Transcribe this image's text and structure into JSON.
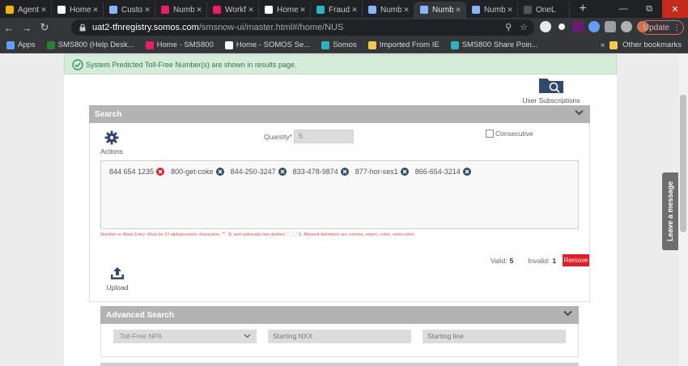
{
  "browser": {
    "tabs": [
      {
        "title": "Agent",
        "color": "#f4b400",
        "active": false
      },
      {
        "title": "Home",
        "color": "#ffffff",
        "active": false
      },
      {
        "title": "Custo",
        "color": "#8ab4f8",
        "active": false
      },
      {
        "title": "Numb",
        "color": "#e91e63",
        "active": false
      },
      {
        "title": "Workf",
        "color": "#e91e63",
        "active": false
      },
      {
        "title": "Home",
        "color": "#ffffff",
        "active": false
      },
      {
        "title": "Fraud",
        "color": "#2bb3c0",
        "active": false
      },
      {
        "title": "Numb",
        "color": "#8ab4f8",
        "active": false
      },
      {
        "title": "Numb",
        "color": "#8ab4f8",
        "active": true
      },
      {
        "title": "Numb",
        "color": "#8ab4f8",
        "active": false
      },
      {
        "title": "OneL",
        "color": "#555555",
        "active": false
      }
    ],
    "new_tab": "+",
    "url_host": "uat2-tfnregistry.somos.com",
    "url_path": "/smsnow-ui/master.html#/home/NUS",
    "update_label": "Update"
  },
  "bookmarks": [
    {
      "label": "Apps",
      "color": "#5f9ff5"
    },
    {
      "label": "SMS800 (Help Desk...",
      "color": "#2e7d32"
    },
    {
      "label": "Home - SMS800",
      "color": "#e91e63"
    },
    {
      "label": "Home - SOMOS Se...",
      "color": "#ffffff"
    },
    {
      "label": "Somos",
      "color": "#2bb3c0"
    },
    {
      "label": "Imported From IE",
      "color": "#f2c94c"
    },
    {
      "label": "SMS800 Share Poin...",
      "color": "#2bb3c0"
    }
  ],
  "bookmarks_other": "Other bookmarks",
  "alert": {
    "message": "System Predicted Toll-Free Number(s) are shown in results page."
  },
  "user_subscriptions": "User Subscriptions",
  "search": {
    "title": "Search",
    "actions_label": "Actions",
    "quantity_label": "Quantity",
    "quantity_required": "*",
    "quantity_value": "5",
    "consecutive_label": "Consecutive",
    "numbers": [
      "844 654 1235",
      "800-get-coke",
      "844-250-3247",
      "833-478-9874",
      "877-hor-ses1",
      "866-654-3214"
    ],
    "hint": "Number or Mask Entry: Must be 10 alphanumeric characters, '*', '&' and optionally two dashes '-', '...' (). Allowed delimiters are comma, return, colon, semi-colon.",
    "valid_label": "Valid:",
    "valid_count": "5",
    "invalid_label": "Invalid:",
    "invalid_count": "1",
    "remove_label": "Remove",
    "upload_label": "Upload"
  },
  "advanced_search": {
    "title": "Advanced Search",
    "npa_selected": "Toll-Free NPA",
    "nxx_placeholder": "Starting NXX",
    "line_placeholder": "Starting line"
  },
  "feedback_label": "Leave a message",
  "colors": {
    "alert_bg": "#d4edda",
    "section_header": "#b3b3b3",
    "remove": "#e41e26",
    "chip_remove": "#e41e26",
    "chip_neutral": "#2f4a6b",
    "icon_navy": "#2f4a6b"
  }
}
